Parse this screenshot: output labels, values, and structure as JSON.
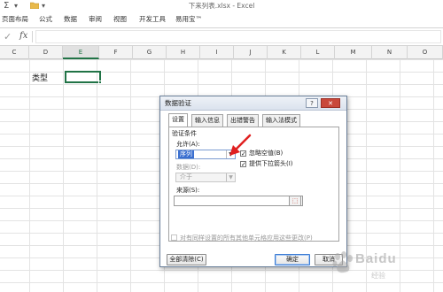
{
  "window": {
    "title": "下来列表.xlsx - Excel",
    "quick_access": {
      "sum_icon": "Σ",
      "folder_icon": "folder-icon"
    }
  },
  "ribbon": {
    "tabs": [
      "页面布局",
      "公式",
      "数据",
      "审阅",
      "视图",
      "开发工具",
      "易用宝™"
    ]
  },
  "formula_bar": {
    "check_symbol": "✓",
    "fx_label": "fx",
    "value": ""
  },
  "sheet": {
    "columns": [
      "C",
      "D",
      "E",
      "F",
      "G",
      "H",
      "I",
      "J",
      "K",
      "L",
      "M",
      "N",
      "O"
    ],
    "active_column": "E",
    "cell_text": "类型",
    "accent_color": "#217346"
  },
  "dialog": {
    "title": "数据验证",
    "help_button": "?",
    "close_button": "✕",
    "tabs": [
      "设置",
      "输入信息",
      "出错警告",
      "输入法模式"
    ],
    "active_tab": "设置",
    "section_title": "验证条件",
    "allow_label": "允许(A):",
    "allow_value": "序列",
    "data_label": "数据(D):",
    "data_value": "介于",
    "ignore_blank": {
      "label": "忽略空值(B)",
      "checked": true
    },
    "in_cell_dropdown": {
      "label": "提供下拉箭头(I)",
      "checked": true
    },
    "source_label": "来源(S):",
    "source_value": "",
    "apply_all": {
      "label": "对有同样设置的所有其他单元格应用这些更改(P)",
      "checked": false,
      "enabled": false
    },
    "buttons": {
      "clear_all": "全部清除(C)",
      "ok": "确定",
      "cancel": "取消"
    }
  },
  "annotation": {
    "color": "#e02020"
  },
  "watermark": {
    "text": "Baidu",
    "sub": "经验"
  }
}
